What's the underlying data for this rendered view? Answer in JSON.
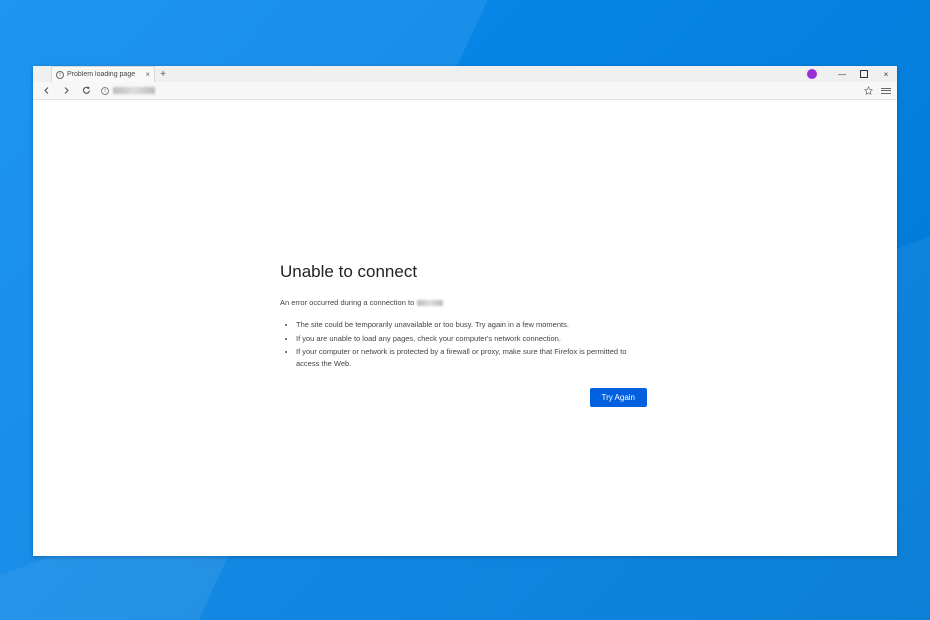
{
  "tab": {
    "title": "Problem loading page",
    "info_char": "i",
    "close_char": "×"
  },
  "newtab_char": "+",
  "window": {
    "min_char": "—",
    "close_char": "×"
  },
  "toolbar": {
    "url_info_char": "i"
  },
  "error": {
    "title": "Unable to connect",
    "subtitle_prefix": "An error occurred during a connection to",
    "bullets": [
      "The site could be temporarily unavailable or too busy. Try again in a few moments.",
      "If you are unable to load any pages, check your computer's network connection.",
      "If your computer or network is protected by a firewall or proxy, make sure that Firefox is permitted to access the Web."
    ],
    "try_again": "Try Again"
  }
}
